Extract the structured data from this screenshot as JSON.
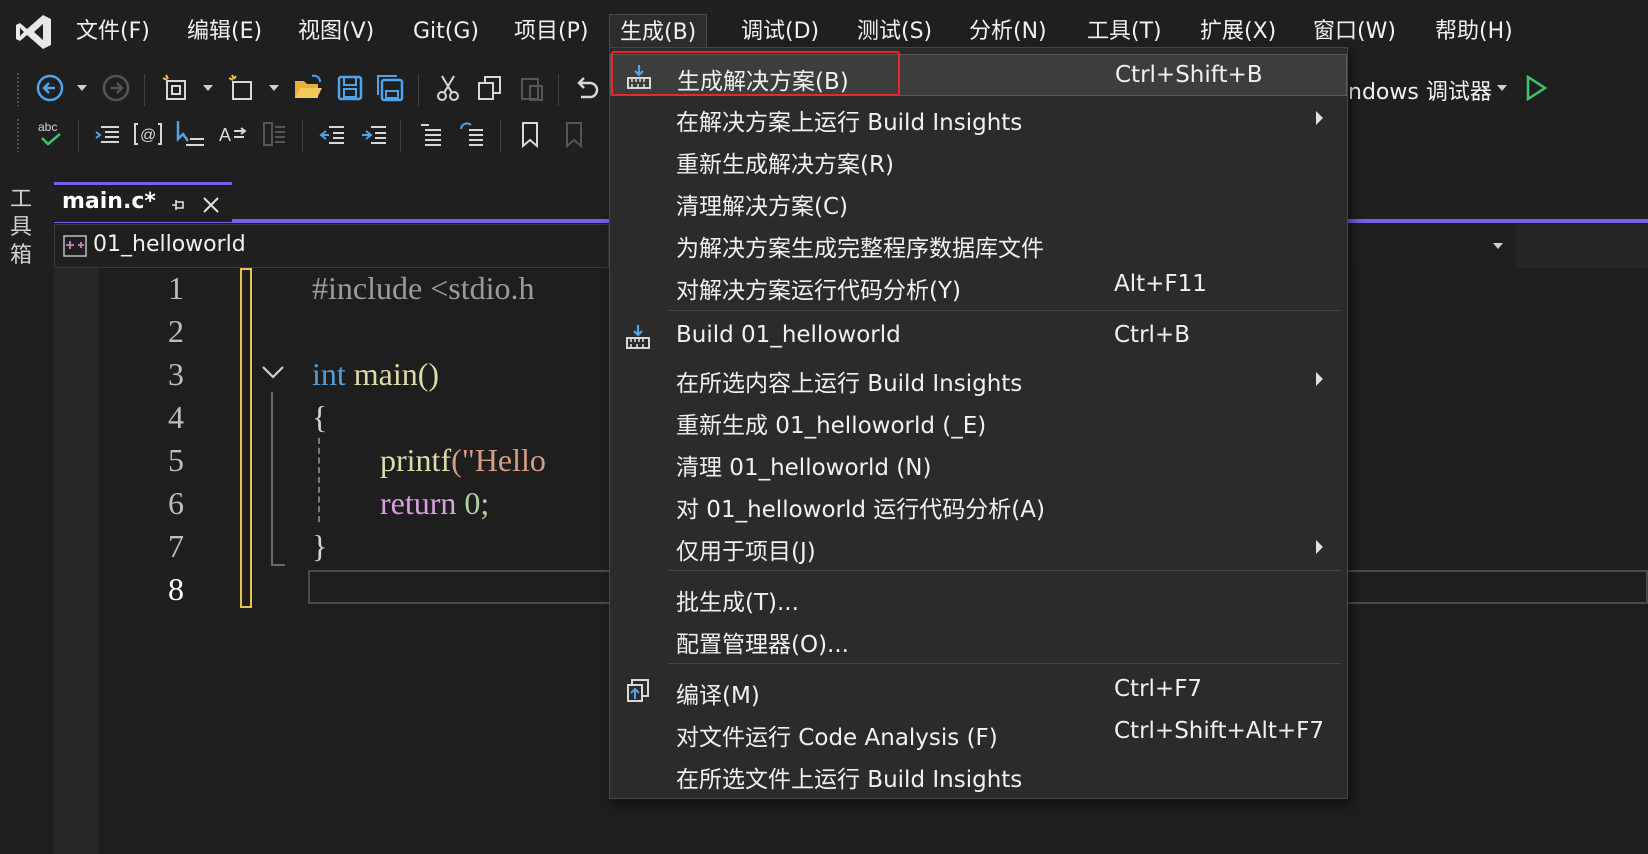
{
  "menubar": {
    "items": [
      "文件(F)",
      "编辑(E)",
      "视图(V)",
      "Git(G)",
      "项目(P)",
      "生成(B)",
      "调试(D)",
      "测试(S)",
      "分析(N)",
      "工具(T)",
      "扩展(X)",
      "窗口(W)",
      "帮助(H)"
    ],
    "active": "生成(B)"
  },
  "toolbar": {
    "debugger_label": "ndows 调试器"
  },
  "rail": {
    "toolbox_label": "工具箱"
  },
  "tab": {
    "title": "main.c*"
  },
  "navbar": {
    "project": "01_helloworld"
  },
  "editor": {
    "line_numbers": [
      "1",
      "2",
      "3",
      "4",
      "5",
      "6",
      "7",
      "8"
    ],
    "lines": {
      "l1": "#include <stdio.h",
      "l3_kw": "int",
      "l3_fn": " main()",
      "l4": "{",
      "l5_fn": "printf",
      "l5_str": "(\"Hello",
      "l6_kw": "return",
      "l6_num": " 0;",
      "l7": "}"
    }
  },
  "build_menu": {
    "items": [
      {
        "label": "生成解决方案(B)",
        "shortcut": "Ctrl+Shift+B"
      },
      {
        "label": "在解决方案上运行 Build Insights",
        "shortcut": ""
      },
      {
        "label": "重新生成解决方案(R)",
        "shortcut": ""
      },
      {
        "label": "清理解决方案(C)",
        "shortcut": ""
      },
      {
        "label": "为解决方案生成完整程序数据库文件",
        "shortcut": ""
      },
      {
        "label": "对解决方案运行代码分析(Y)",
        "shortcut": "Alt+F11"
      },
      {
        "label": "Build 01_helloworld",
        "shortcut": "Ctrl+B"
      },
      {
        "label": "在所选内容上运行 Build Insights",
        "shortcut": ""
      },
      {
        "label": "重新生成 01_helloworld (_E)",
        "shortcut": ""
      },
      {
        "label": "清理 01_helloworld (N)",
        "shortcut": ""
      },
      {
        "label": "对 01_helloworld 运行代码分析(A)",
        "shortcut": ""
      },
      {
        "label": "仅用于项目(J)",
        "shortcut": ""
      },
      {
        "label": "批生成(T)...",
        "shortcut": ""
      },
      {
        "label": "配置管理器(O)...",
        "shortcut": ""
      },
      {
        "label": "编译(M)",
        "shortcut": "Ctrl+F7"
      },
      {
        "label": "对文件运行 Code Analysis (F)",
        "shortcut": "Ctrl+Shift+Alt+F7"
      },
      {
        "label": "在所选文件上运行 Build Insights",
        "shortcut": ""
      }
    ]
  },
  "colors": {
    "accent": "#7160e8",
    "highlight_box": "#e8272b",
    "keyword": "#569cd6",
    "function": "#dcdcaa",
    "string": "#d69d85",
    "control_keyword": "#d8a0df"
  }
}
